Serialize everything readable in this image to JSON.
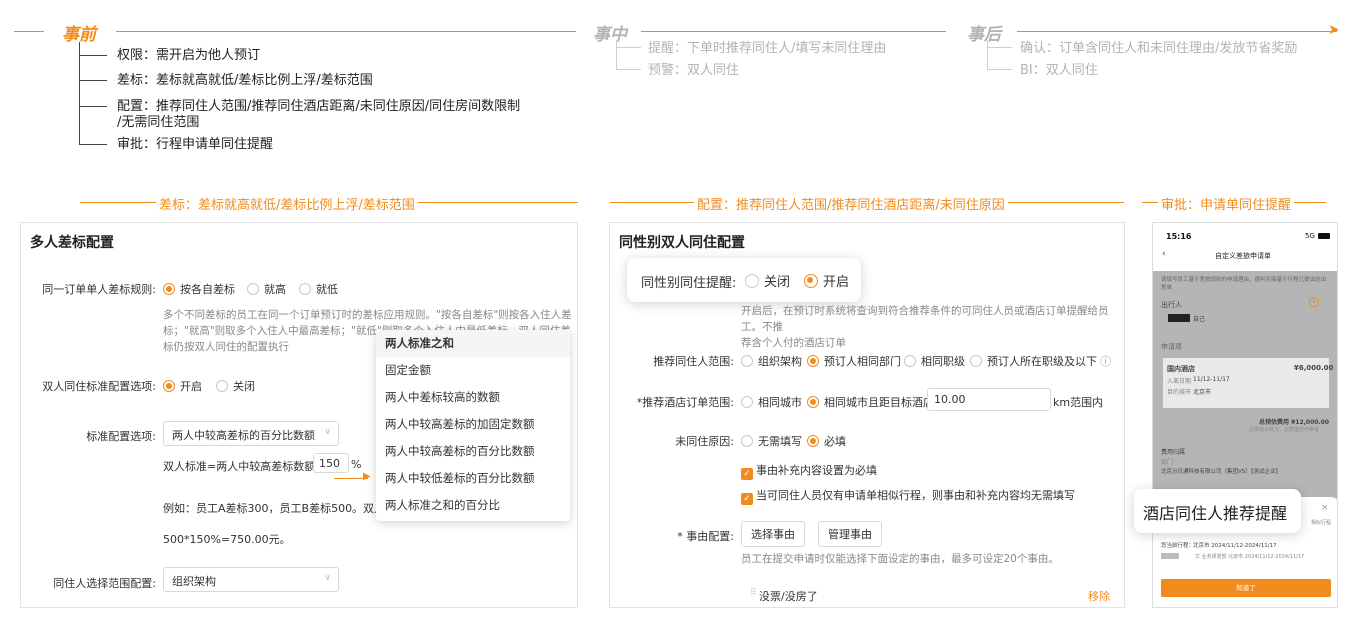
{
  "timeline": {
    "before": {
      "label": "事前",
      "items": [
        "权限：需开启为他人预订",
        "差标：差标就高就低/差标比例上浮/差标范围",
        "配置：推荐同住人范围/推荐同住酒店距离/未同住原因/同住房间数限制",
        "/无需同住范围",
        "审批：行程申请单同住提醒"
      ]
    },
    "during": {
      "label": "事中",
      "items": [
        "提醒：下单时推荐同住人/填写未同住理由",
        "预警：双人同住"
      ]
    },
    "after": {
      "label": "事后",
      "items": [
        "确认：订单含同住人和未同住理由/发放节省奖励",
        "BI：双人同住"
      ]
    }
  },
  "sections": {
    "s1": "差标：差标就高就低/差标比例上浮/差标范围",
    "s2": "配置：推荐同住人范围/推荐同住酒店距离/未同住原因",
    "s3": "审批：申请单同住提醒"
  },
  "panel1": {
    "title": "多人差标配置",
    "rule_label": "同一订单单人差标规则:",
    "rule_options": [
      "按各自差标",
      "就高",
      "就低"
    ],
    "rule_note": [
      "多个不同差标的员工在同一个订单预订时的差标应用规则。\"按各自差标\"则按各入住人差",
      "标；\"就高\"则取多个入住人中最高差标；\"就低\"则取多个入住人中最低差标。双人同住差",
      "标仍按双人同住的配置执行"
    ],
    "dual_label": "双人同住标准配置选项:",
    "dual_options": [
      "开启",
      "关闭"
    ],
    "std_label": "标准配置选项:",
    "std_value": "两人中较高差标的百分比数额",
    "formula_prefix": "双人标准=两人中较高差标数额*",
    "formula_value": "150",
    "formula_unit": "%",
    "example": "例如：员工A差标300，员工B差标500。双人",
    "example2": "500*150%=750.00元。",
    "scope_label": "同住人选择范围配置:",
    "scope_value": "组织架构",
    "dropdown": [
      "两人标准之和",
      "固定金额",
      "两人中差标较高的数额",
      "两人中较高差标的加固定数额",
      "两人中较高差标的百分比数额",
      "两人中较低差标的百分比数额",
      "两人标准之和的百分比"
    ]
  },
  "panel2": {
    "title": "同性别双人同住配置",
    "remind_label": "同性别同住提醒:",
    "remind_options": [
      "关闭",
      "开启"
    ],
    "remind_note": [
      "开启后，在预订时系统将查询到符合推荐条件的可同住人员或酒店订单提醒给员工。不推",
      "荐含个人付的酒店订单"
    ],
    "range_label": "推荐同住人范围:",
    "range_options": [
      "组织架构",
      "预订人相同部门",
      "相同职级",
      "预订人所在职级及以下"
    ],
    "hotel_label": "*推荐酒店订单范围:",
    "hotel_options": [
      "相同城市",
      "相同城市且距目标酒店"
    ],
    "hotel_distance": "10.00",
    "hotel_unit": "km范围内",
    "reason_label": "未同住原因:",
    "reason_options": [
      "无需填写",
      "必填"
    ],
    "check1": "事由补充内容设置为必填",
    "check2": "当可同住人员仅有申请单相似行程，则事由和补充内容均无需填写",
    "config_label": "* 事由配置:",
    "btn_select": "选择事由",
    "btn_manage": "管理事由",
    "config_note": "员工在提交申请时仅能选择下面设定的事由，最多可设定20个事由。",
    "reason_item": "没票/没房了",
    "remove": "移除"
  },
  "phone": {
    "time": "15:16",
    "signal": "5G",
    "title": "自定义差旅申请单",
    "intro": "请填写员工基于差旅规则的申请理由，便利对接基于行程已提出的出差单",
    "traveler_label": "出行人",
    "traveler_tag": "自己",
    "apply_label": "申请项",
    "hotel_title": "国内酒店",
    "hotel_price": "¥6,000.00",
    "hotel_date_label": "入离日期",
    "hotel_date": "11/12-11/17",
    "hotel_city_label": "目的城市",
    "hotel_city": "北京市",
    "total": "总预估费用 ¥12,000.00",
    "total_sub": "总费用大概为，此数值仅作参考",
    "belong_label": "费用归属",
    "dept_label": "部门",
    "company": "北京分贝通科技有限公司（集团VS）【测试企业】",
    "popup_title": "酒店同住人推荐提醒",
    "route_label": "您当前行程：",
    "route": "北京市 2024/11/12-2024/11/17",
    "route2": "文 业务研发部 北京市 2024/11/12-2024/11/17",
    "side_hint": "相似行程",
    "ok": "知道了"
  },
  "colors": {
    "accent": "#f08c1e",
    "muted": "#b3b3b3"
  }
}
